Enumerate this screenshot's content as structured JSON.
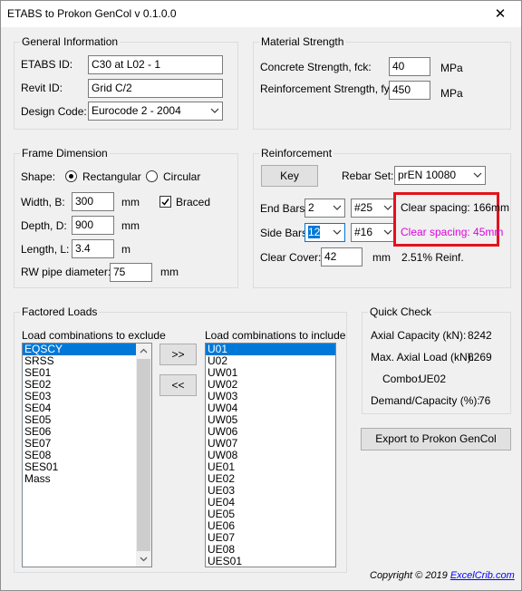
{
  "window": {
    "title": "ETABS to Prokon GenCol v 0.1.0.0",
    "close_glyph": "✕"
  },
  "general": {
    "legend": "General Information",
    "etabs_label": "ETABS ID:",
    "etabs_value": "C30 at L02 - 1",
    "revit_label": "Revit ID:",
    "revit_value": "Grid C/2",
    "code_label": "Design Code:",
    "code_value": "Eurocode 2 - 2004"
  },
  "material": {
    "legend": "Material Strength",
    "fck_label": "Concrete Strength, fck:",
    "fck_value": "40",
    "fck_unit": "MPa",
    "fy_label": "Reinforcement Strength, fy:",
    "fy_value": "450",
    "fy_unit": "MPa"
  },
  "frame": {
    "legend": "Frame Dimension",
    "shape_label": "Shape:",
    "rect_label": "Rectangular",
    "circ_label": "Circular",
    "width_label": "Width, B:",
    "width_value": "300",
    "width_unit": "mm",
    "braced_label": "Braced",
    "braced_checked": true,
    "depth_label": "Depth, D:",
    "depth_value": "900",
    "depth_unit": "mm",
    "length_label": "Length, L:",
    "length_value": "3.4",
    "length_unit": "m",
    "rw_label": "RW pipe diameter:",
    "rw_value": "75",
    "rw_unit": "mm"
  },
  "reinforcement": {
    "legend": "Reinforcement",
    "key_label": "Key",
    "rebarset_label": "Rebar Set:",
    "rebarset_value": "prEN 10080",
    "endbars_label": "End Bars:",
    "endbars_count": "2",
    "endbars_size": "#25",
    "sidebars_label": "Side Bars:",
    "sidebars_count": "12",
    "sidebars_size": "#16",
    "clear_end": "Clear spacing: 166mm",
    "clear_side": "Clear spacing: 45mm",
    "clear_side_color": "#e000e0",
    "highlight_color": "#e4121c",
    "cover_label": "Clear Cover:",
    "cover_value": "42",
    "cover_unit": "mm",
    "reinf_pct": "2.51% Reinf."
  },
  "loads": {
    "legend": "Factored Loads",
    "exclude_label": "Load combinations to exclude",
    "include_label": "Load combinations to include",
    "exclude": [
      "EQSCY",
      "SRSS",
      "SE01",
      "SE02",
      "SE03",
      "SE04",
      "SE05",
      "SE06",
      "SE07",
      "SE08",
      "SES01",
      "Mass"
    ],
    "include": [
      "U01",
      "U02",
      "UW01",
      "UW02",
      "UW03",
      "UW04",
      "UW05",
      "UW06",
      "UW07",
      "UW08",
      "UE01",
      "UE02",
      "UE03",
      "UE04",
      "UE05",
      "UE06",
      "UE07",
      "UE08",
      "UES01"
    ],
    "add_label": ">>",
    "remove_label": "<<"
  },
  "quick": {
    "legend": "Quick Check",
    "axial_cap_label": "Axial Capacity (kN):",
    "axial_cap_value": "8242",
    "max_axial_label": "Max. Axial Load (kN):",
    "max_axial_value": "6269",
    "combo_label": "Combo:",
    "combo_value": "UE02",
    "dc_label": "Demand/Capacity (%):",
    "dc_value": "76"
  },
  "export_label": "Export to Prokon GenCol",
  "copyright": {
    "text": "Copyright © 2019",
    "link": "ExcelCrib.com",
    "link_color": "#0000ff"
  },
  "icons": {
    "combo": "chevron-down-icon",
    "scroll_up": "scroll-up-icon",
    "scroll_down": "scroll-down-icon"
  }
}
